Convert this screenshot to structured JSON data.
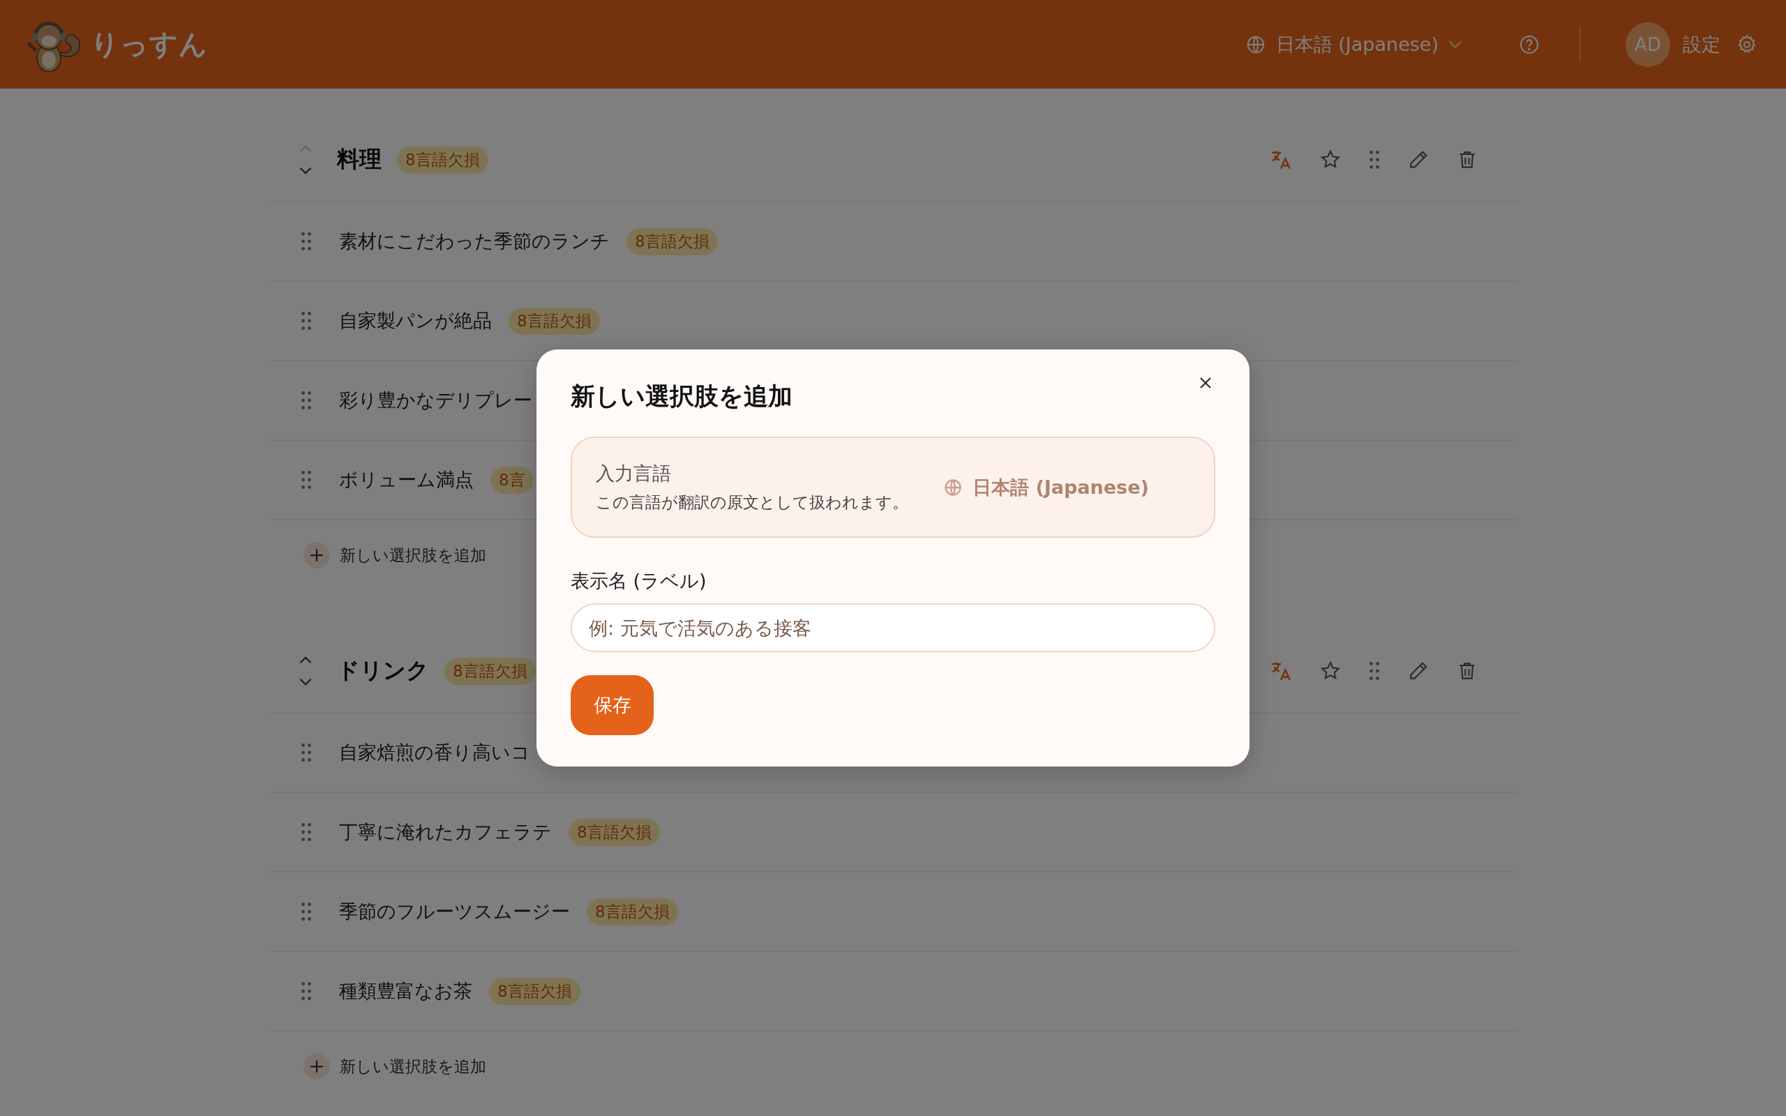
{
  "header": {
    "brand": "りっすん",
    "language": "日本語 (Japanese)",
    "avatar": "AD",
    "settings": "設定"
  },
  "categories": [
    {
      "name": "料理",
      "badge": "8言語欠損",
      "can_move_up": false,
      "add_label": "新しい選択肢を追加",
      "items": [
        {
          "label": "素材にこだわった季節のランチ",
          "badge": "8言語欠損"
        },
        {
          "label": "自家製パンが絶品",
          "badge": "8言語欠損"
        },
        {
          "label": "彩り豊かなデリプレー"
        },
        {
          "label": "ボリューム満点",
          "badge": "8言"
        }
      ]
    },
    {
      "name": "ドリンク",
      "badge": "8言語欠損",
      "can_move_up": true,
      "add_label": "新しい選択肢を追加",
      "items": [
        {
          "label": "自家焙煎の香り高いコ"
        },
        {
          "label": "丁寧に淹れたカフェラテ",
          "badge": "8言語欠損"
        },
        {
          "label": "季節のフルーツスムージー",
          "badge": "8言語欠損"
        },
        {
          "label": "種類豊富なお茶",
          "badge": "8言語欠損"
        }
      ]
    }
  ],
  "dialog": {
    "title": "新しい選択肢を追加",
    "input_language": {
      "label": "入力言語",
      "description": "この言語が翻訳の原文として扱われます。",
      "value": "日本語 (Japanese)"
    },
    "field_label": "表示名 (ラベル)",
    "placeholder": "例: 元気で活気のある接客",
    "save": "保存"
  }
}
